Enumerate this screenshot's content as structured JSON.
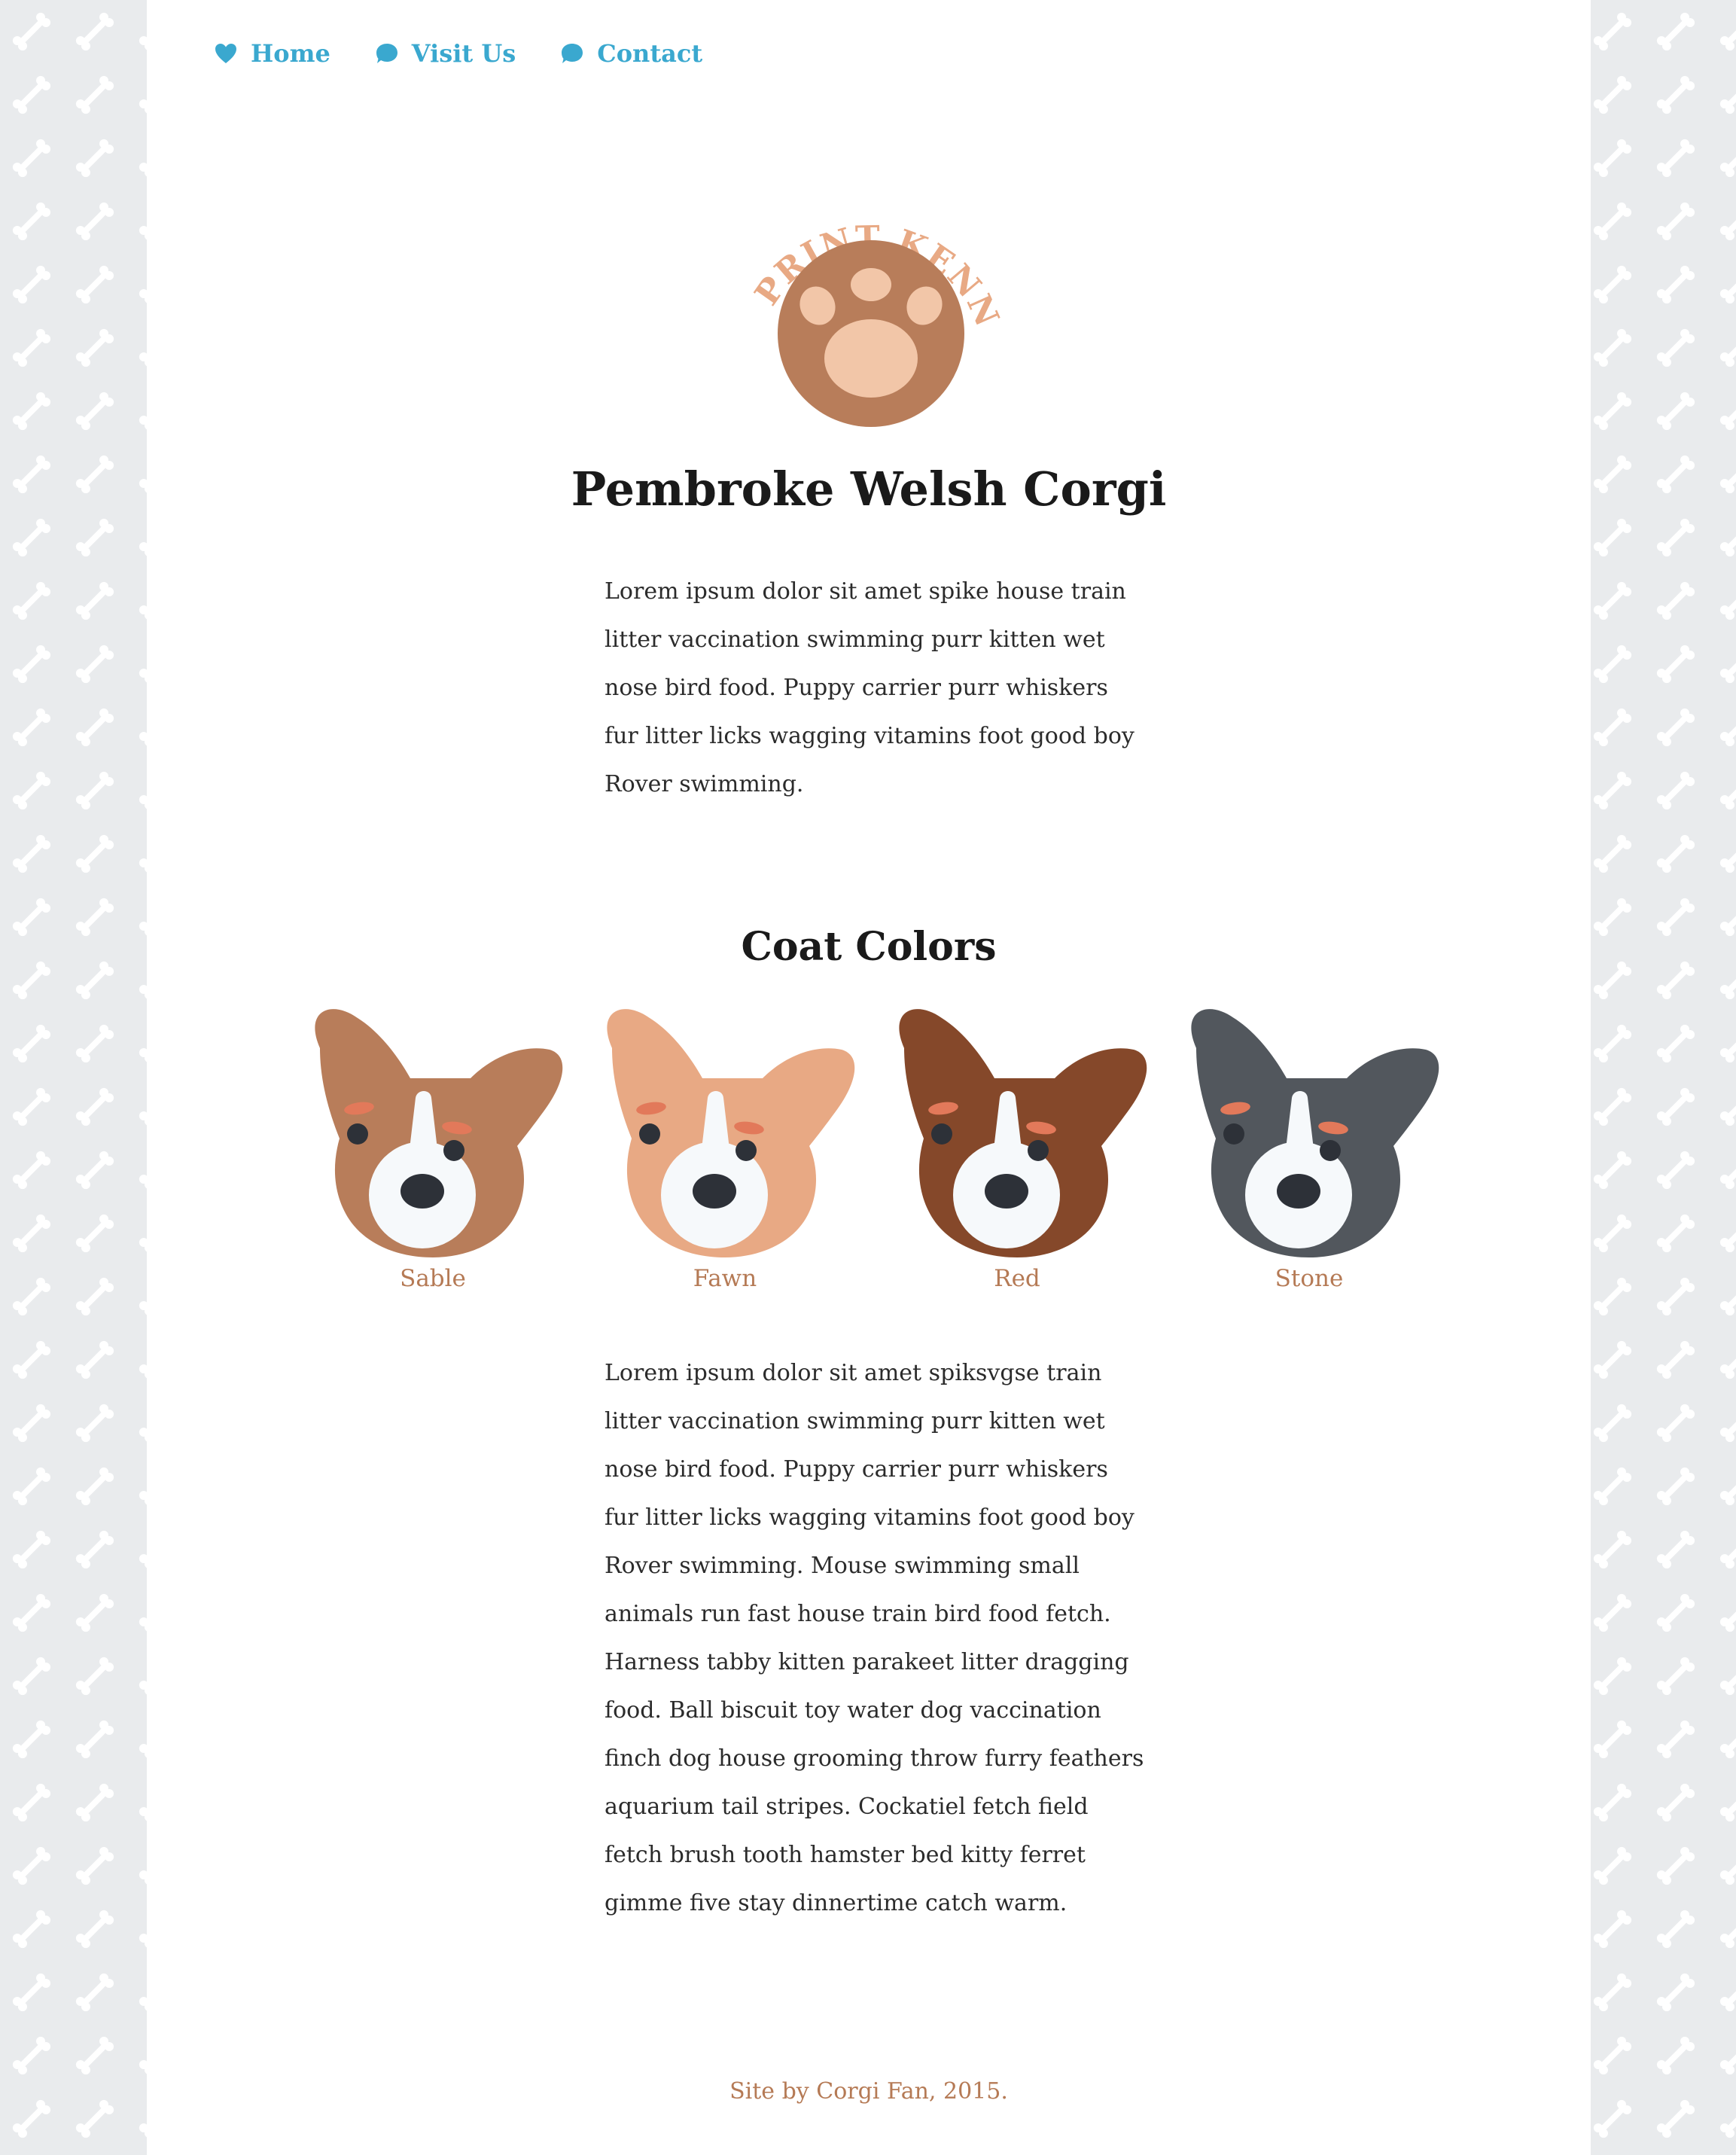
{
  "nav": {
    "items": [
      {
        "label": "Home",
        "icon": "heart-icon"
      },
      {
        "label": "Visit Us",
        "icon": "speech-bubble-icon"
      },
      {
        "label": "Contact",
        "icon": "speech-bubble-icon"
      }
    ]
  },
  "logo": {
    "text": "PAW PRINT KENNELS"
  },
  "page_title": "Pembroke Welsh Corgi",
  "intro_text": "Lorem ipsum dolor sit amet spike house train litter vaccination swimming purr kitten wet nose bird food. Puppy carrier purr whiskers fur litter licks wagging vitamins foot good boy Rover swimming.",
  "coat_section": {
    "title": "Coat Colors",
    "dogs": [
      {
        "label": "Sable",
        "color": "#b87d5a"
      },
      {
        "label": "Fawn",
        "color": "#e8a984"
      },
      {
        "label": "Red",
        "color": "#85482a"
      },
      {
        "label": "Stone",
        "color": "#52575d"
      }
    ]
  },
  "body_text": "Lorem ipsum dolor sit amet spiksvgse train litter vaccination swimming purr kitten wet nose bird food. Puppy carrier purr whiskers fur litter licks wagging vitamins foot good boy Rover swimming. Mouse swimming small animals run fast house train bird food fetch. Harness tabby kitten parakeet litter dragging food. Ball biscuit toy water dog vaccination finch dog house grooming throw furry feathers aquarium tail stripes. Cockatiel fetch field fetch brush tooth hamster bed kitty ferret gimme five stay dinnertime catch warm.",
  "footer": "Site by Corgi Fan, 2015.",
  "colors": {
    "link": "#3aa8cf",
    "accent": "#b57a55",
    "logo_ring": "#e8a984",
    "logo_circle": "#b87d5a",
    "logo_pad": "#f2c6a8",
    "background": "#e9ebed"
  }
}
